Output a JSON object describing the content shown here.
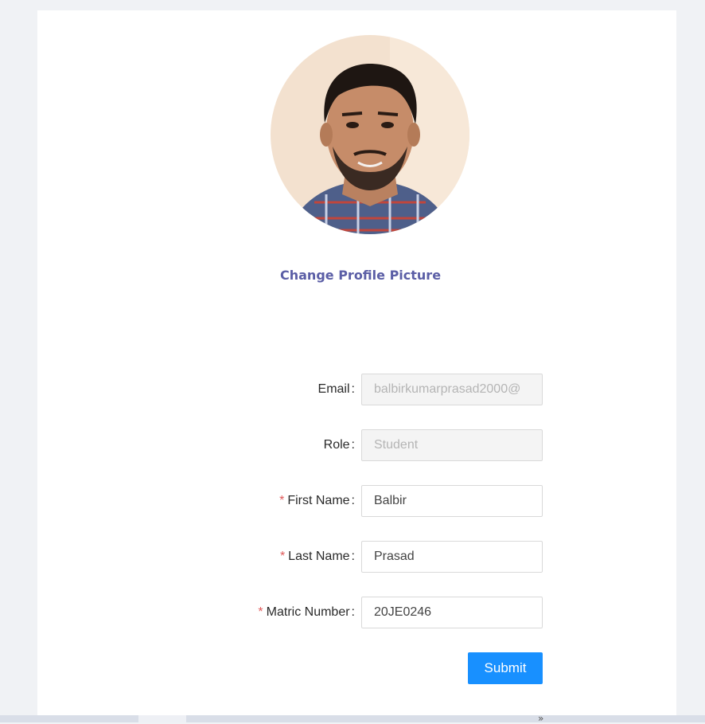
{
  "profile": {
    "change_picture_label": "Change Profile Picture"
  },
  "form": {
    "email": {
      "label": "Email",
      "value": "balbirkumarprasad2000@",
      "disabled": true
    },
    "role": {
      "label": "Role",
      "value": "Student",
      "disabled": true
    },
    "first_name": {
      "label": "First Name",
      "value": "Balbir",
      "required": true
    },
    "last_name": {
      "label": "Last Name",
      "value": "Prasad",
      "required": true
    },
    "matric_number": {
      "label": "Matric Number",
      "value": "20JE0246",
      "required": true
    },
    "colon": ":",
    "required_mark": "*",
    "submit_label": "Submit"
  },
  "scrollbar": {
    "arrow": "»"
  },
  "colors": {
    "background": "#f0f2f5",
    "card": "#ffffff",
    "link": "#5b5ea6",
    "primary": "#1890ff",
    "required": "#e05a5a"
  }
}
